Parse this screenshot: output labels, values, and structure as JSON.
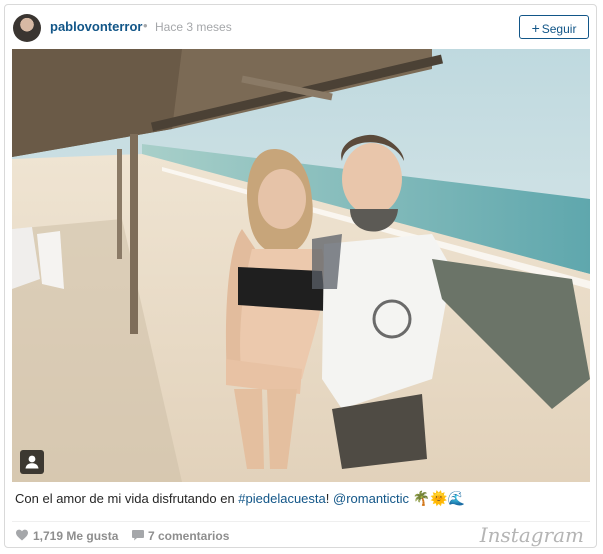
{
  "post": {
    "username": "pablovonterror",
    "separator": "•",
    "time": "Hace 3 meses",
    "follow_label": "Seguir",
    "follow_plus": "+",
    "caption": {
      "text": "Con el amor de mi vida disfrutando en ",
      "hashtag": "#piedelacuesta",
      "middle": "! ",
      "mention": "@romantictic",
      "emojis": "🌴🌞🌊"
    },
    "likes": "1,719 Me gusta",
    "comments": "7 comentarios",
    "brand": "Instagram"
  },
  "icons": {
    "avatar": "avatar",
    "user_tag": "user-tag-icon",
    "like": "heart-icon",
    "comment": "comment-bubble-icon"
  },
  "colors": {
    "link": "#125688",
    "muted": "#a5a7aa",
    "count": "#8e8e8e"
  }
}
